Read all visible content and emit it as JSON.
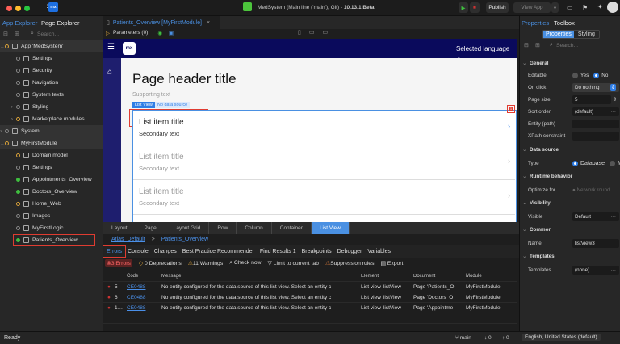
{
  "titlebar": {
    "title": "MedSystem (Main line ('main'), Git) -",
    "version": "10.13.1 Beta",
    "publish": "Publish",
    "view_app": "View App",
    "logo": "mx"
  },
  "left_panel": {
    "tabs": [
      "App Explorer",
      "Page Explorer"
    ],
    "search_placeholder": "Search...",
    "tree": [
      {
        "label": "App 'MedSystem'",
        "level": 0,
        "status": "yellow",
        "section": true,
        "expanded": true
      },
      {
        "label": "Settings",
        "level": 1,
        "status": "none"
      },
      {
        "label": "Security",
        "level": 1,
        "status": "none"
      },
      {
        "label": "Navigation",
        "level": 1,
        "status": "none"
      },
      {
        "label": "System texts",
        "level": 1,
        "status": "none"
      },
      {
        "label": "Styling",
        "level": 1,
        "status": "none",
        "collapsed": true
      },
      {
        "label": "Marketplace modules",
        "level": 1,
        "status": "yellow",
        "collapsed": true
      },
      {
        "label": "System",
        "level": 0,
        "status": "none",
        "section": true,
        "collapsed": true
      },
      {
        "label": "MyFirstModule",
        "level": 0,
        "status": "yellow",
        "section": true,
        "expanded": true
      },
      {
        "label": "Domain model",
        "level": 1,
        "status": "yellow"
      },
      {
        "label": "Settings",
        "level": 1,
        "status": "none"
      },
      {
        "label": "Appointments_Overview",
        "level": 1,
        "status": "green"
      },
      {
        "label": "Doctors_Overview",
        "level": 1,
        "status": "green"
      },
      {
        "label": "Home_Web",
        "level": 1,
        "status": "yellow"
      },
      {
        "label": "Images",
        "level": 1,
        "status": "none"
      },
      {
        "label": "MyFirstLogic",
        "level": 1,
        "status": "none"
      },
      {
        "label": "Patients_Overview",
        "level": 1,
        "status": "green",
        "highlighted": true
      }
    ]
  },
  "editor": {
    "tab": "Patients_Overview [MyFirstModule]",
    "parameters": "Parameters (0)",
    "canvas": {
      "logo": "mx",
      "language": "Selected language",
      "page_title": "Page header title",
      "supporting": "Supporting text",
      "lv_badge": "List View",
      "lv_source": "No data source",
      "error_count": "1",
      "items": [
        {
          "title": "List item title",
          "sub": "Secondary text"
        },
        {
          "title": "List item title",
          "sub": "Secondary text"
        },
        {
          "title": "List item title",
          "sub": "Secondary text"
        }
      ]
    },
    "breadcrumb": [
      "Layout",
      "Page",
      "Layout Grid",
      "Row",
      "Column",
      "Container",
      "List View"
    ],
    "path": [
      "Atlas_Default",
      ">",
      "Patients_Overview"
    ]
  },
  "bottom": {
    "tabs": [
      "Errors",
      "Console",
      "Changes",
      "Best Practice Recommender",
      "Find Results 1",
      "Breakpoints",
      "Debugger",
      "Variables"
    ],
    "toolbar": {
      "errors": "3 Errors",
      "deprecations": "0 Deprecations",
      "warnings": "11 Warnings",
      "check": "Check now",
      "limit": "Limit to current tab",
      "suppression": "Suppression rules",
      "export": "Export"
    },
    "columns": [
      "",
      "",
      "Code",
      "Message",
      "Element",
      "Document",
      "Module"
    ],
    "rows": [
      {
        "num": "5",
        "code": "CE0488",
        "message": "No entity configured for the data source of this list view. Select an entity c",
        "element": "List view 'listView",
        "document": "Page 'Patients_O",
        "module": "MyFirstModule"
      },
      {
        "num": "6",
        "code": "CE0488",
        "message": "No entity configured for the data source of this list view. Select an entity c",
        "element": "List view 'listView",
        "document": "Page 'Doctors_O",
        "module": "MyFirstModule"
      },
      {
        "num": "1…",
        "code": "CE0488",
        "message": "No entity configured for the data source of this list view. Select an entity c",
        "element": "List view 'listView",
        "document": "Page 'Appointme",
        "module": "MyFirstModule"
      }
    ]
  },
  "right_panel": {
    "tabs": [
      "Properties",
      "Toolbox"
    ],
    "seg": [
      "Properties",
      "Styling"
    ],
    "search_placeholder": "Search...",
    "general": "General",
    "editable": "Editable",
    "yes": "Yes",
    "no": "No",
    "on_click": "On click",
    "on_click_val": "Do nothing",
    "page_size": "Page size",
    "page_size_val": "5",
    "sort_order": "Sort order",
    "sort_val": "(default)",
    "entity": "Entity (path)",
    "xpath": "XPath constraint",
    "data_source": "Data source",
    "type": "Type",
    "database": "Database",
    "m": "M",
    "runtime": "Runtime behavior",
    "optimize": "Optimize for",
    "network": "Network round",
    "visibility": "Visibility",
    "visible": "Visible",
    "visible_val": "Default",
    "common": "Common",
    "name": "Name",
    "name_val": "listView3",
    "templates_h": "Templates",
    "templates": "Templates",
    "templates_val": "(none)"
  },
  "status": {
    "ready": "Ready",
    "branch": "main",
    "down": "↓ 0",
    "up": "↑ 0",
    "language": "English, United States (default)"
  },
  "colors": {
    "accent": "#4a90e2",
    "navy": "#0a0a5c",
    "error": "#e03c31",
    "green": "#3fbf3f"
  }
}
